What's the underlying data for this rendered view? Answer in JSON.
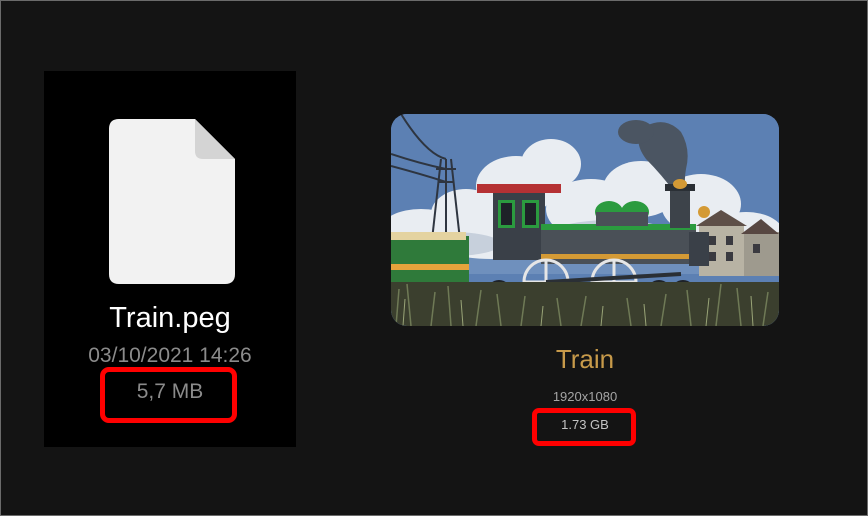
{
  "left_file": {
    "name": "Train.peg",
    "date": "03/10/2021 14:26",
    "size": "5,7 MB",
    "icon": "document-icon"
  },
  "right_photo": {
    "title": "Train",
    "dimensions": "1920x1080",
    "size": "1.73 GB",
    "thumbnail": "train-photo-thumbnail"
  },
  "colors": {
    "background": "#141414",
    "tile_background": "#000000",
    "highlight": "#ff0000",
    "photo_title": "#c79a4a",
    "secondary_text": "#8b8b8b"
  }
}
